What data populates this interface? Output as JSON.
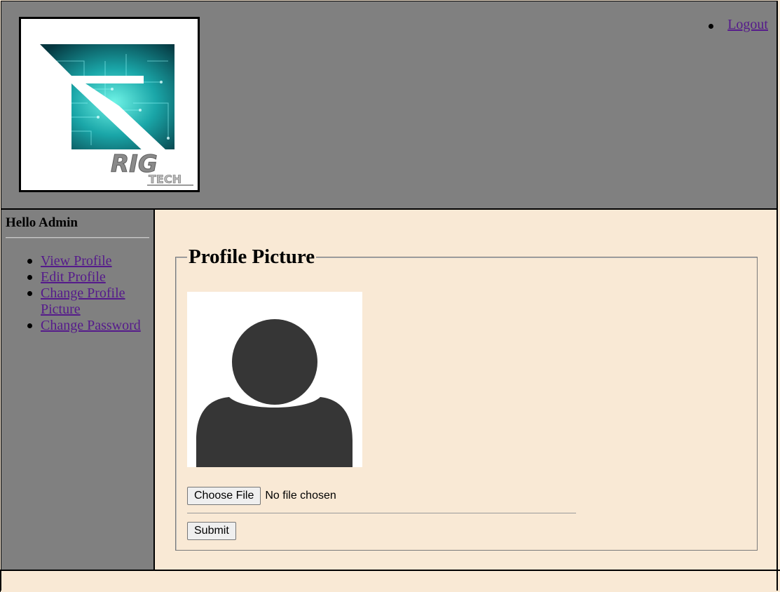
{
  "header": {
    "logo": {
      "brand_text": "RIG",
      "sub_text": "TECH",
      "icon": "rig-tech-logo-icon"
    },
    "nav": [
      {
        "label": "Logout"
      }
    ]
  },
  "sidebar": {
    "greeting": "Hello Admin",
    "items": [
      {
        "label": "View Profile"
      },
      {
        "label": "Edit Profile"
      },
      {
        "label": "Change Profile Picture"
      },
      {
        "label": "Change Password"
      }
    ]
  },
  "main": {
    "legend": "Profile Picture",
    "avatar_icon": "default-user-avatar-icon",
    "file_input": {
      "button_label": "Choose File",
      "status": "No file chosen"
    },
    "submit_label": "Submit"
  },
  "colors": {
    "header_bg": "#808080",
    "content_bg": "#f9e9d5",
    "link": "#551a8b",
    "logo_accent": "#1fb5b0"
  }
}
